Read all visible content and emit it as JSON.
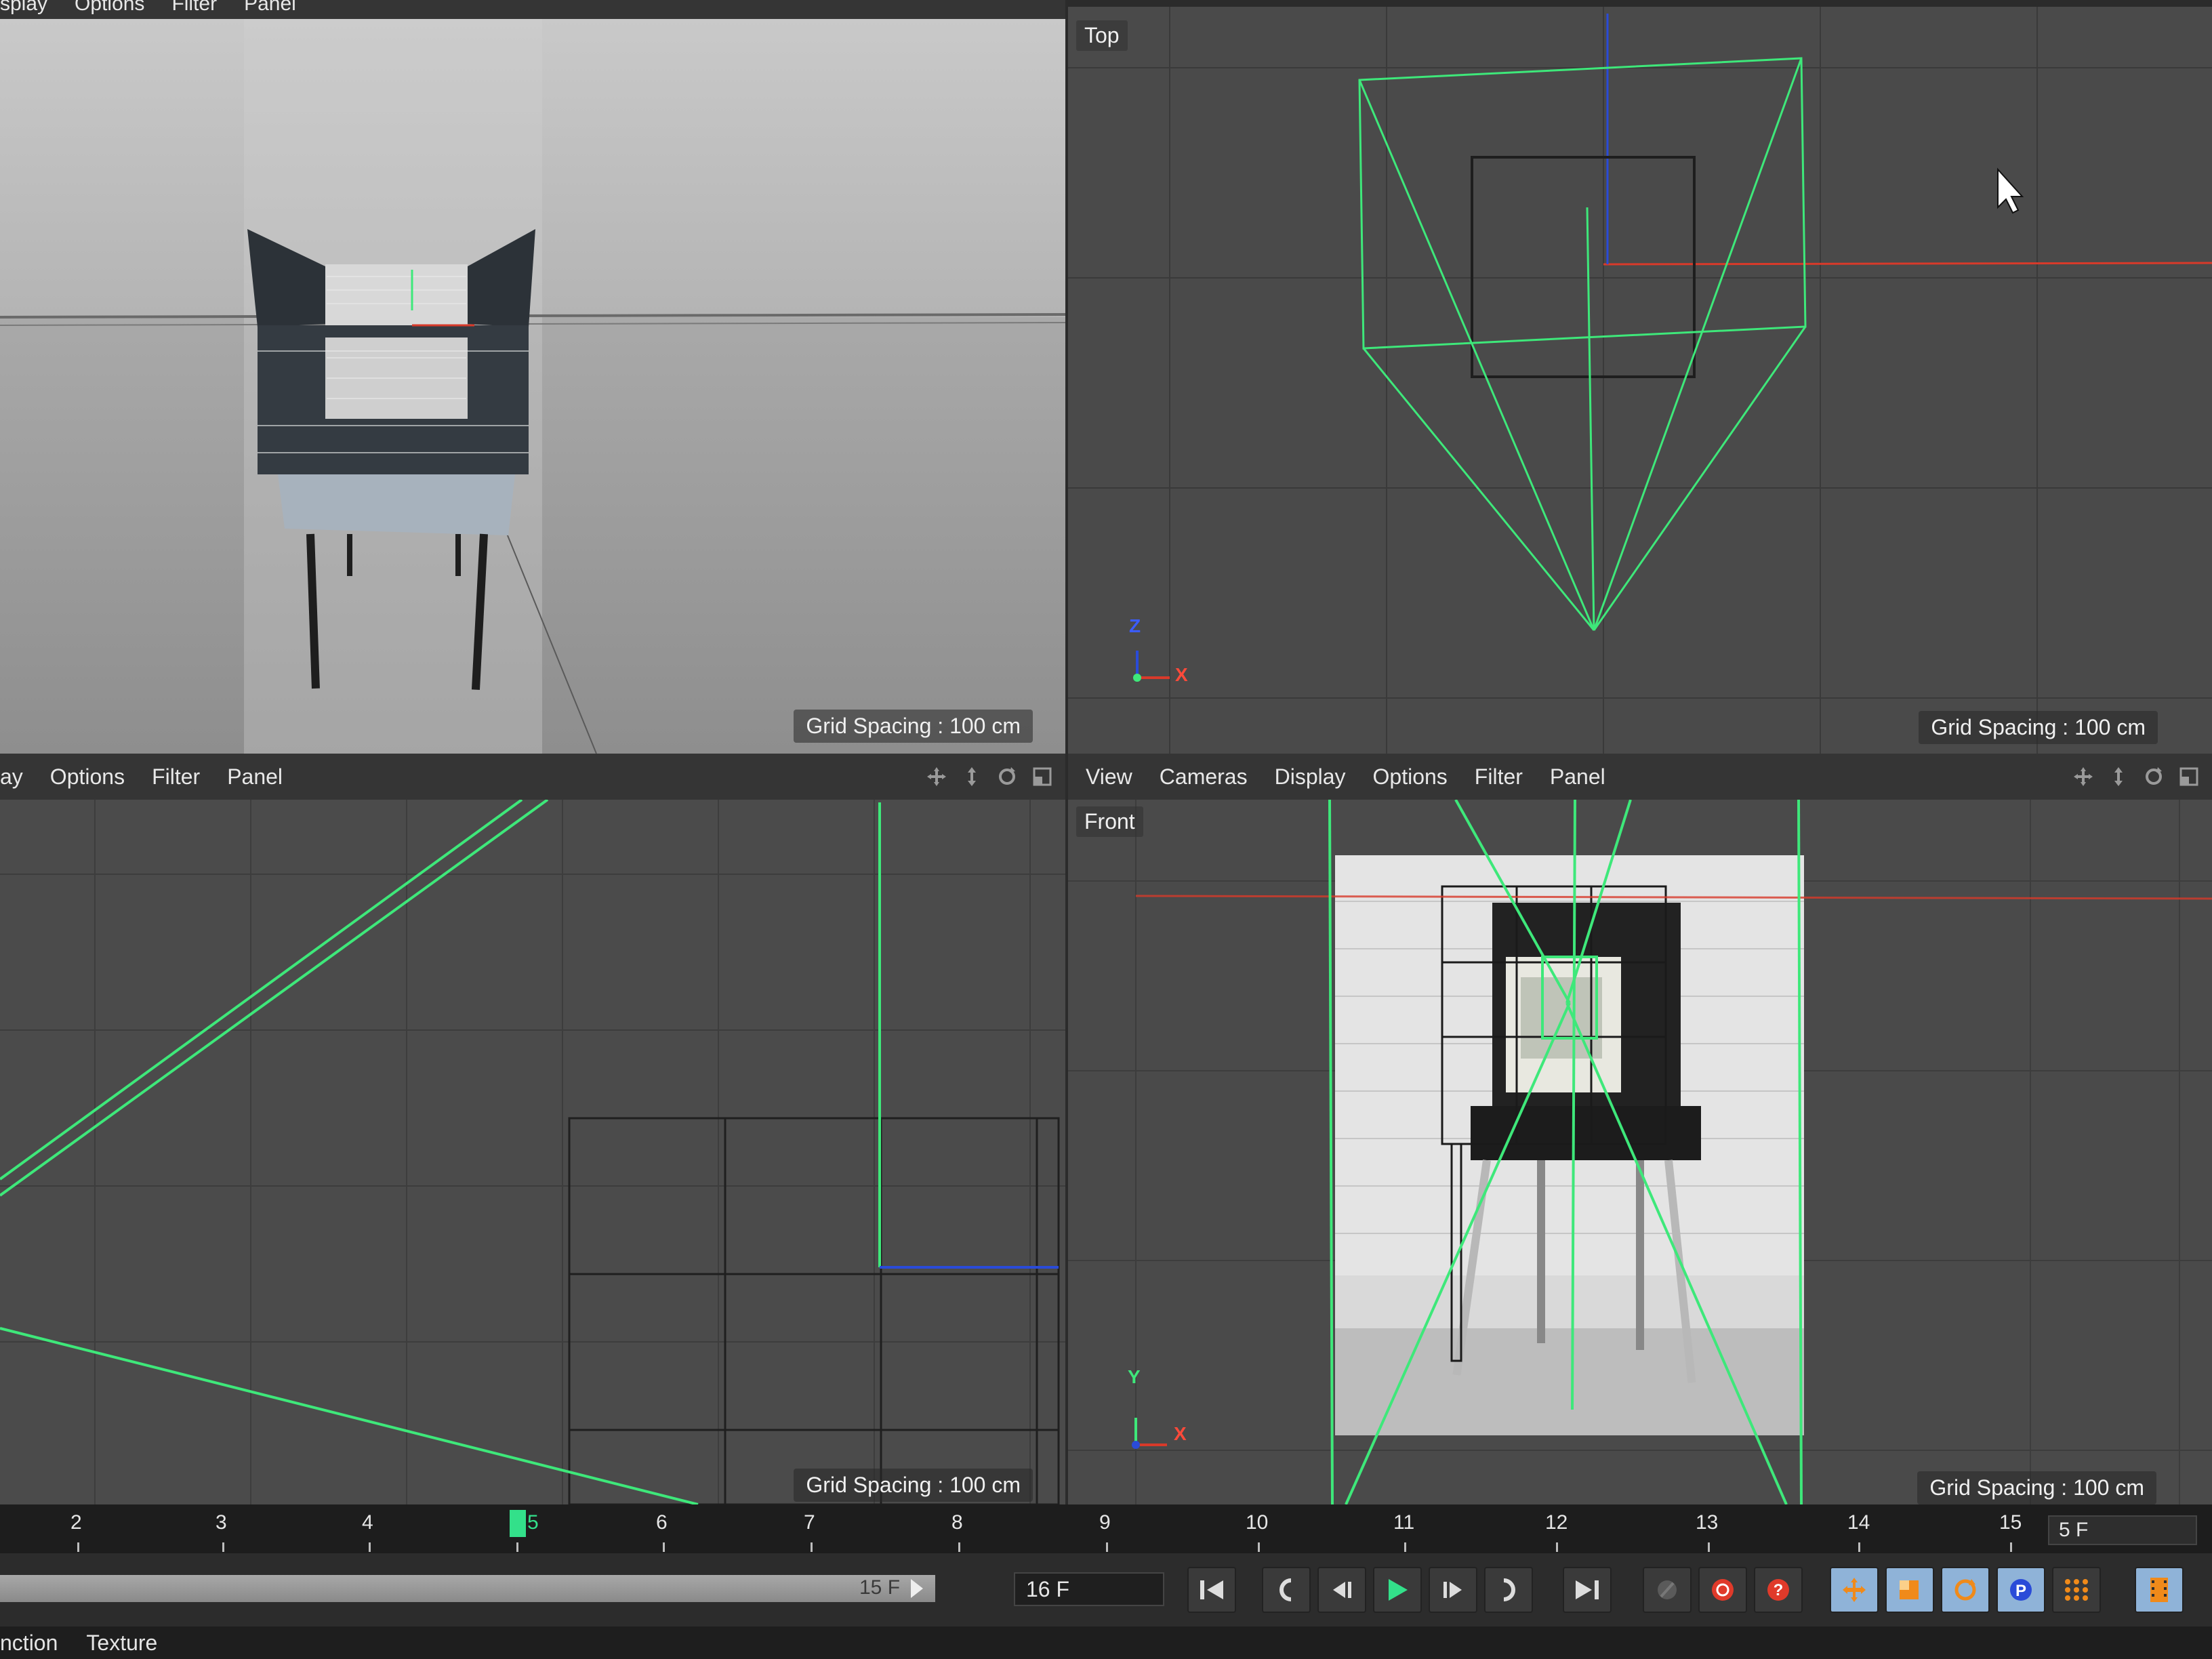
{
  "viewport_tl": {
    "menu": [
      "splay",
      "Options",
      "Filter",
      "Panel"
    ],
    "grid_spacing": "Grid Spacing : 100 cm"
  },
  "viewport_tr": {
    "menu": [
      "View",
      "Cameras",
      "Display",
      "Options",
      "Filter",
      "Panel"
    ],
    "view_name": "Top",
    "axis_labels": {
      "up": "Z",
      "right": "X",
      "dot": "Y"
    },
    "grid_spacing": "Grid Spacing : 100 cm"
  },
  "viewport_bl": {
    "menu": [
      "ay",
      "Options",
      "Filter",
      "Panel"
    ],
    "grid_spacing": "Grid Spacing : 100 cm"
  },
  "viewport_br": {
    "menu": [
      "View",
      "Cameras",
      "Display",
      "Options",
      "Filter",
      "Panel"
    ],
    "view_name": "Front",
    "axis_labels": {
      "up": "Y",
      "right": "X",
      "dot": "Z"
    },
    "grid_spacing": "Grid Spacing : 100 cm"
  },
  "nav_icons": [
    "move-view-icon",
    "zoom-view-icon",
    "rotate-view-icon",
    "toggle-panel-icon"
  ],
  "timeline": {
    "frames": [
      "2",
      "3",
      "4",
      "6",
      "7",
      "8",
      "9",
      "10",
      "11",
      "12",
      "13",
      "14",
      "15"
    ],
    "current": "5",
    "range_end": "5 F"
  },
  "transport": {
    "range_label": "15 F",
    "current_frame": "16 F",
    "buttons": [
      "go-to-start",
      "previous-key",
      "previous-frame",
      "play-forward",
      "next-frame",
      "next-key",
      "go-to-end",
      "autokey",
      "record-active-objects",
      "autokey-help",
      "key-position",
      "key-scale",
      "key-rotation",
      "key-parameter",
      "key-point-level",
      "timeline-window"
    ]
  },
  "bottom_tabs": [
    "nction",
    "Texture"
  ],
  "colors": {
    "green_wire": "#3ee87a",
    "axis_blue": "#2a4bd8",
    "axis_red": "#d83a2a",
    "accent_orange": "#f08a1a",
    "key_blue": "#8fb3d8"
  }
}
